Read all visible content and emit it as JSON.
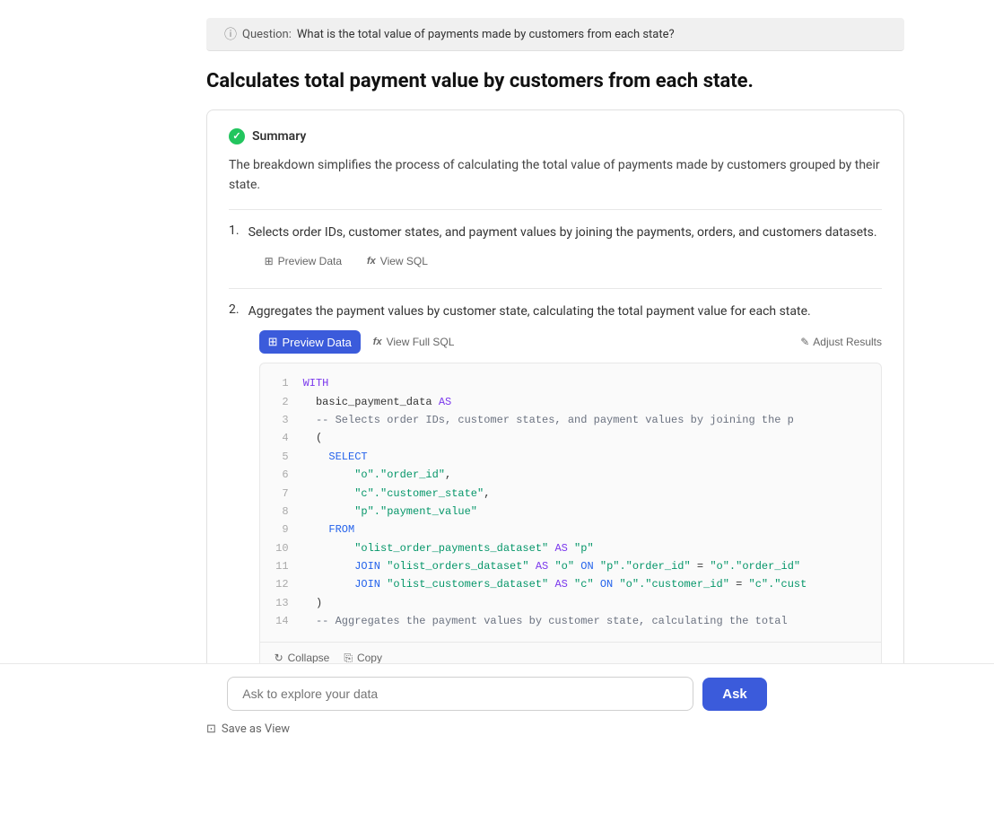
{
  "question_bar": {
    "icon_label": "?",
    "label": "Question:",
    "text": "What is the total value of payments made by customers from each state?"
  },
  "page_title": "Calculates total payment value by customers from each state.",
  "summary": {
    "label": "Summary",
    "text": "The breakdown simplifies the process of calculating the total value of payments made by customers grouped by their state."
  },
  "steps": [
    {
      "number": "1",
      "text": "Selects order IDs, customer states, and payment values by joining the payments, orders, and customers datasets.",
      "actions": [
        {
          "label": "Preview Data",
          "icon": "grid",
          "active": false
        },
        {
          "label": "View SQL",
          "icon": "fx",
          "active": false
        }
      ]
    },
    {
      "number": "2",
      "text": "Aggregates the payment values by customer state, calculating the total payment value for each state.",
      "actions_left": [
        {
          "label": "Preview Data",
          "icon": "grid",
          "active": true
        },
        {
          "label": "View Full SQL",
          "icon": "fx",
          "active": false
        }
      ],
      "adjust_label": "Adjust Results"
    }
  ],
  "code": {
    "lines": [
      {
        "num": "1",
        "code": "WITH",
        "parts": [
          {
            "text": "WITH",
            "cls": "kw"
          }
        ]
      },
      {
        "num": "2",
        "code": "    basic_payment_data AS",
        "parts": [
          {
            "text": "    basic_payment_data ",
            "cls": ""
          },
          {
            "text": "AS",
            "cls": "kw"
          }
        ]
      },
      {
        "num": "3",
        "code": "    -- Selects order IDs, customer states, and payment values by joining the p",
        "parts": [
          {
            "text": "    -- Selects order IDs, customer states, and payment values by joining the p",
            "cls": "comment"
          }
        ]
      },
      {
        "num": "4",
        "code": "    (",
        "parts": [
          {
            "text": "    (",
            "cls": ""
          }
        ]
      },
      {
        "num": "5",
        "code": "        SELECT",
        "parts": [
          {
            "text": "        SELECT",
            "cls": "kw-blue"
          }
        ]
      },
      {
        "num": "6",
        "code": "            \"o\".\"order_id\",",
        "parts": [
          {
            "text": "            ",
            "cls": ""
          },
          {
            "text": "\"o\".\"order_id\",",
            "cls": "str"
          }
        ]
      },
      {
        "num": "7",
        "code": "            \"c\".\"customer_state\",",
        "parts": [
          {
            "text": "            ",
            "cls": ""
          },
          {
            "text": "\"c\".\"customer_state\",",
            "cls": "str"
          }
        ]
      },
      {
        "num": "8",
        "code": "            \"p\".\"payment_value\"",
        "parts": [
          {
            "text": "            ",
            "cls": ""
          },
          {
            "text": "\"p\".\"payment_value\"",
            "cls": "str"
          }
        ]
      },
      {
        "num": "9",
        "code": "        FROM",
        "parts": [
          {
            "text": "        FROM",
            "cls": "kw-blue"
          }
        ]
      },
      {
        "num": "10",
        "code": "            \"olist_order_payments_dataset\" AS \"p\"",
        "parts": [
          {
            "text": "            ",
            "cls": ""
          },
          {
            "text": "\"olist_order_payments_dataset\"",
            "cls": "str"
          },
          {
            "text": " AS ",
            "cls": "kw"
          },
          {
            "text": "\"p\"",
            "cls": "str"
          }
        ]
      },
      {
        "num": "11",
        "code": "            JOIN \"olist_orders_dataset\" AS \"o\" ON \"p\".\"order_id\" = \"o\".\"order_id\"",
        "parts": [
          {
            "text": "            JOIN ",
            "cls": "kw-blue"
          },
          {
            "text": "\"olist_orders_dataset\"",
            "cls": "str"
          },
          {
            "text": " AS ",
            "cls": "kw"
          },
          {
            "text": "\"o\"",
            "cls": "str"
          },
          {
            "text": " ON ",
            "cls": "kw-blue"
          },
          {
            "text": "\"p\".\"order_id\"",
            "cls": "str"
          },
          {
            "text": " = ",
            "cls": ""
          },
          {
            "text": "\"o\".\"order_id\"",
            "cls": "str"
          }
        ]
      },
      {
        "num": "12",
        "code": "            JOIN \"olist_customers_dataset\" AS \"c\" ON \"o\".\"customer_id\" = \"c\".\"cust",
        "parts": [
          {
            "text": "            JOIN ",
            "cls": "kw-blue"
          },
          {
            "text": "\"olist_customers_dataset\"",
            "cls": "str"
          },
          {
            "text": " AS ",
            "cls": "kw"
          },
          {
            "text": "\"c\"",
            "cls": "str"
          },
          {
            "text": " ON ",
            "cls": "kw-blue"
          },
          {
            "text": "\"o\".\"customer_id\"",
            "cls": "str"
          },
          {
            "text": " = ",
            "cls": ""
          },
          {
            "text": "\"c\".\"cust",
            "cls": "str"
          }
        ]
      },
      {
        "num": "13",
        "code": "    )",
        "parts": [
          {
            "text": "    )",
            "cls": ""
          }
        ]
      },
      {
        "num": "14",
        "code": "    -- Aggregates the payment values by customer state, calculating the total",
        "parts": [
          {
            "text": "    -- Aggregates the payment values by customer state, calculating the total",
            "cls": "comment"
          }
        ]
      }
    ],
    "footer_buttons": [
      {
        "label": "Collapse",
        "icon": "↺"
      },
      {
        "label": "Copy",
        "icon": "⎘"
      }
    ]
  },
  "save_view_label": "Save as View",
  "bottom_input_placeholder": "Ask to explore your data",
  "bottom_ask_button": "Ask",
  "icons": {
    "grid": "⊞",
    "fx": "fx",
    "pencil": "✎",
    "save": "⊡",
    "collapse": "↺",
    "copy": "⎘"
  }
}
